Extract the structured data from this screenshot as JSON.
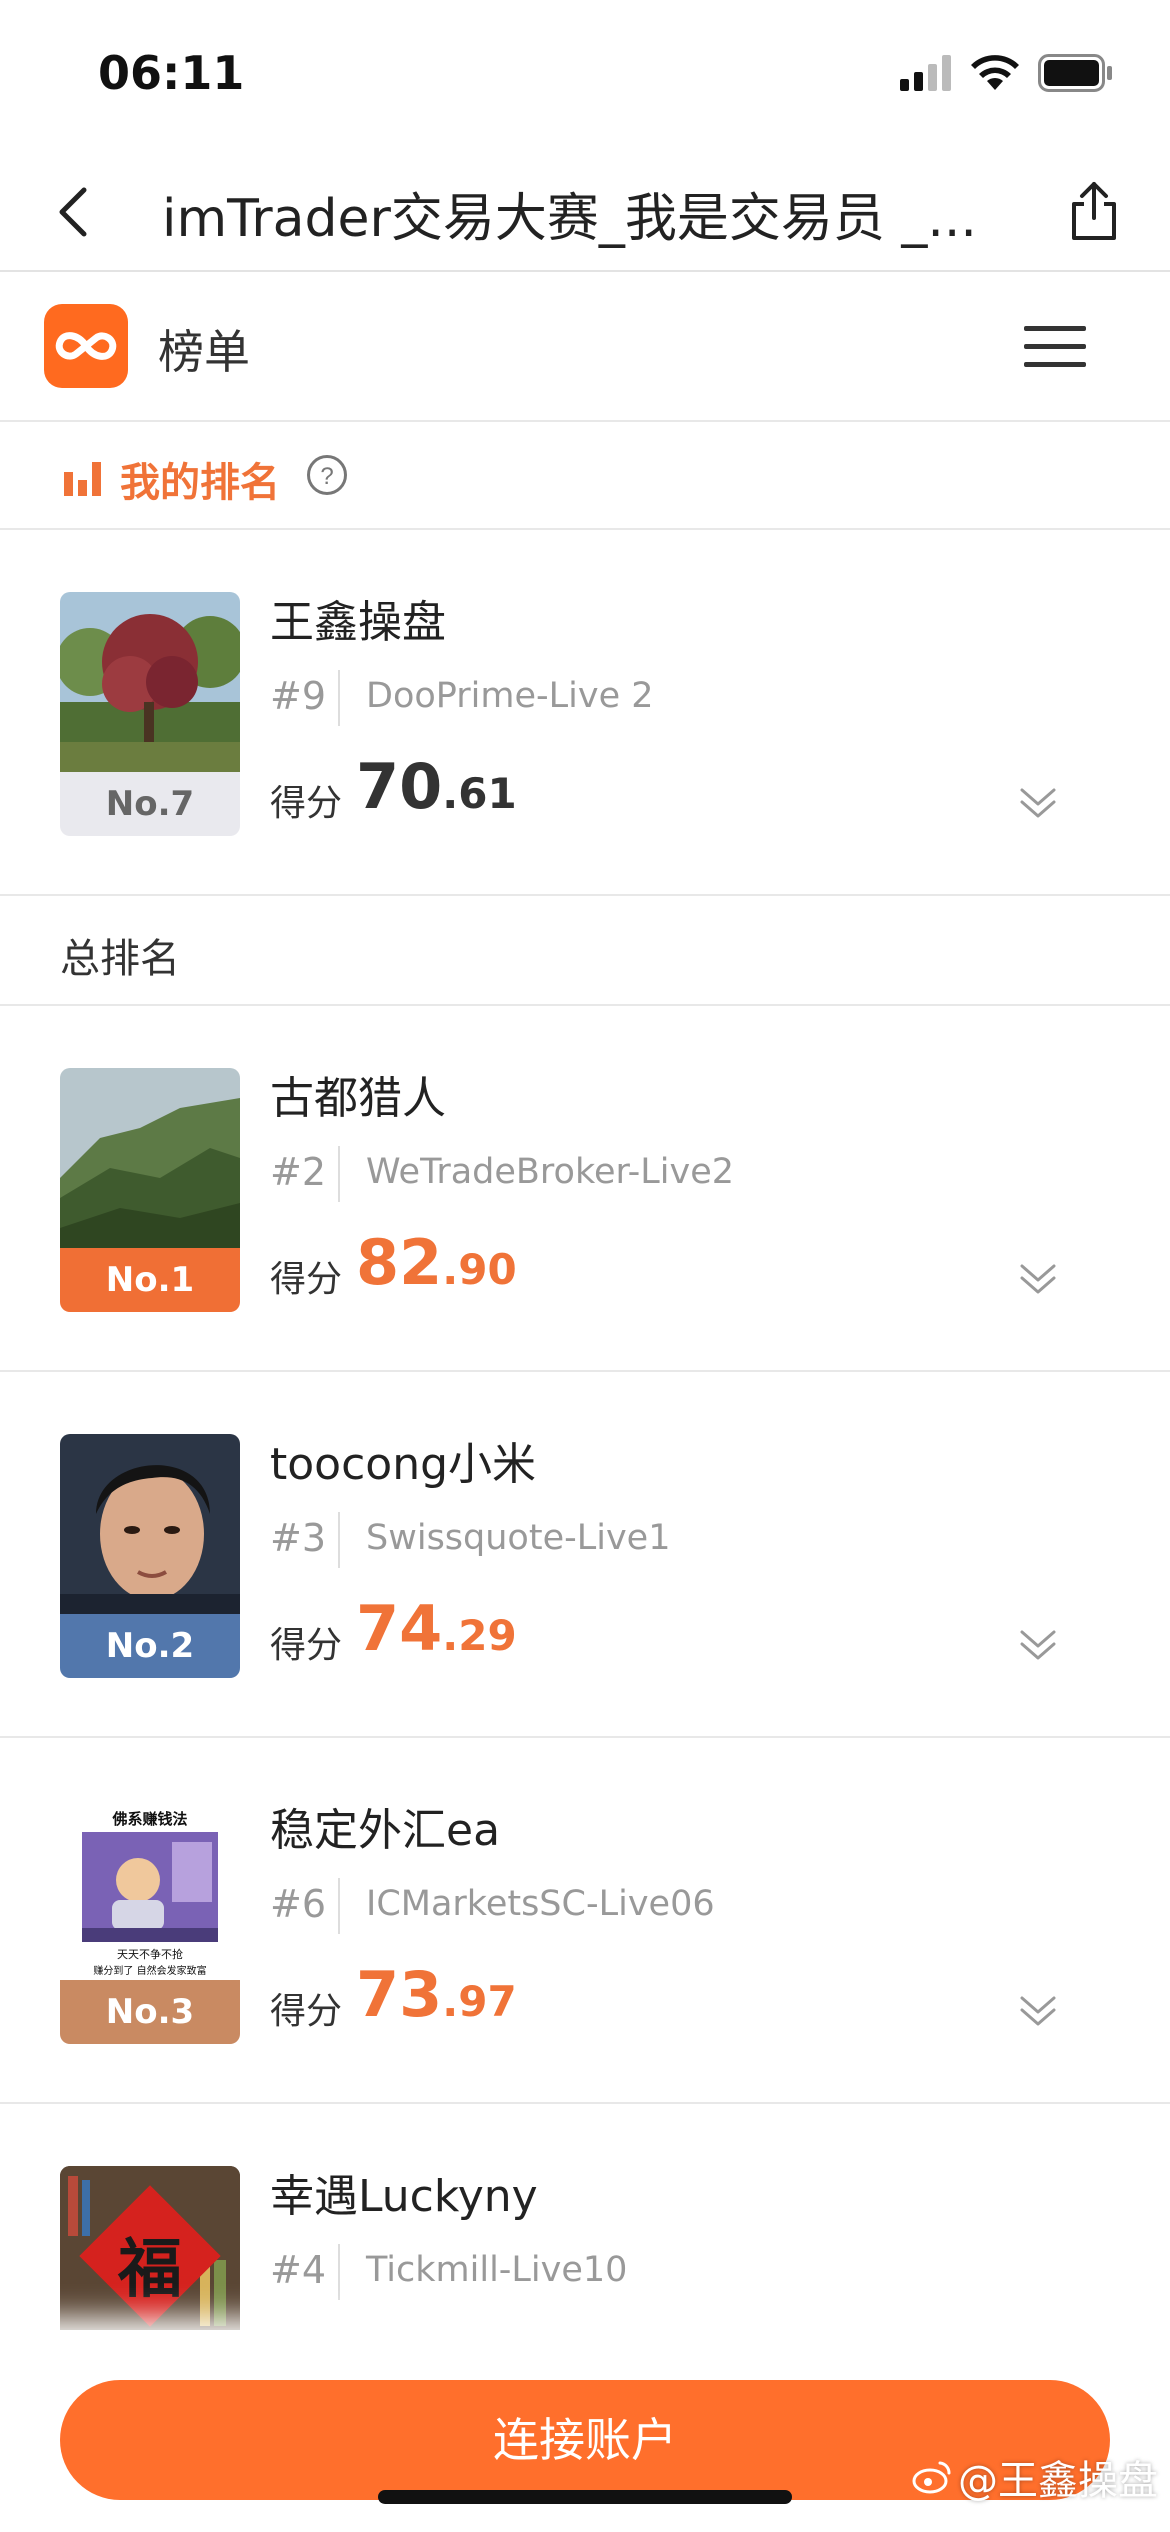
{
  "status": {
    "time": "06:11"
  },
  "nav": {
    "title": "imTrader交易大赛_我是交易员 _..."
  },
  "app": {
    "name": "榜单"
  },
  "my_rank": {
    "label": "我的排名",
    "entry": {
      "badge": "No.7",
      "name": "王鑫操盘",
      "rank": "#9",
      "broker": "DooPrime-Live 2",
      "score_label": "得分",
      "score_int": "70",
      "score_dec": ".61"
    }
  },
  "total_rank": {
    "label": "总排名",
    "entries": [
      {
        "badge": "No.1",
        "name": "古都猎人",
        "rank": "#2",
        "broker": "WeTradeBroker-Live2",
        "score_label": "得分",
        "score_int": "82",
        "score_dec": ".90"
      },
      {
        "badge": "No.2",
        "name": "toocong小米",
        "rank": "#3",
        "broker": "Swissquote-Live1",
        "score_label": "得分",
        "score_int": "74",
        "score_dec": ".29"
      },
      {
        "badge": "No.3",
        "name": "稳定外汇ea",
        "rank": "#6",
        "broker": "ICMarketsSC-Live06",
        "score_label": "得分",
        "score_int": "73",
        "score_dec": ".97"
      },
      {
        "name": "幸遇Luckyny",
        "rank": "#4",
        "broker": "Tickmill-Live10"
      }
    ]
  },
  "avatar_text": {
    "meme_title": "佛系赚钱法",
    "meme_line1": "天天不争不抢",
    "meme_line2": "赚分到了 自然会发家致富",
    "fu": "福"
  },
  "bottom": {
    "connect_label": "连接账户",
    "watermark": "@王鑫操盘"
  },
  "colors": {
    "accent": "#f07338",
    "button": "#ff6f2c",
    "badge_no1": "#f06f35",
    "badge_no2": "#5277ac",
    "badge_no3": "#c98a62",
    "badge_other": "#e9e9ee"
  }
}
